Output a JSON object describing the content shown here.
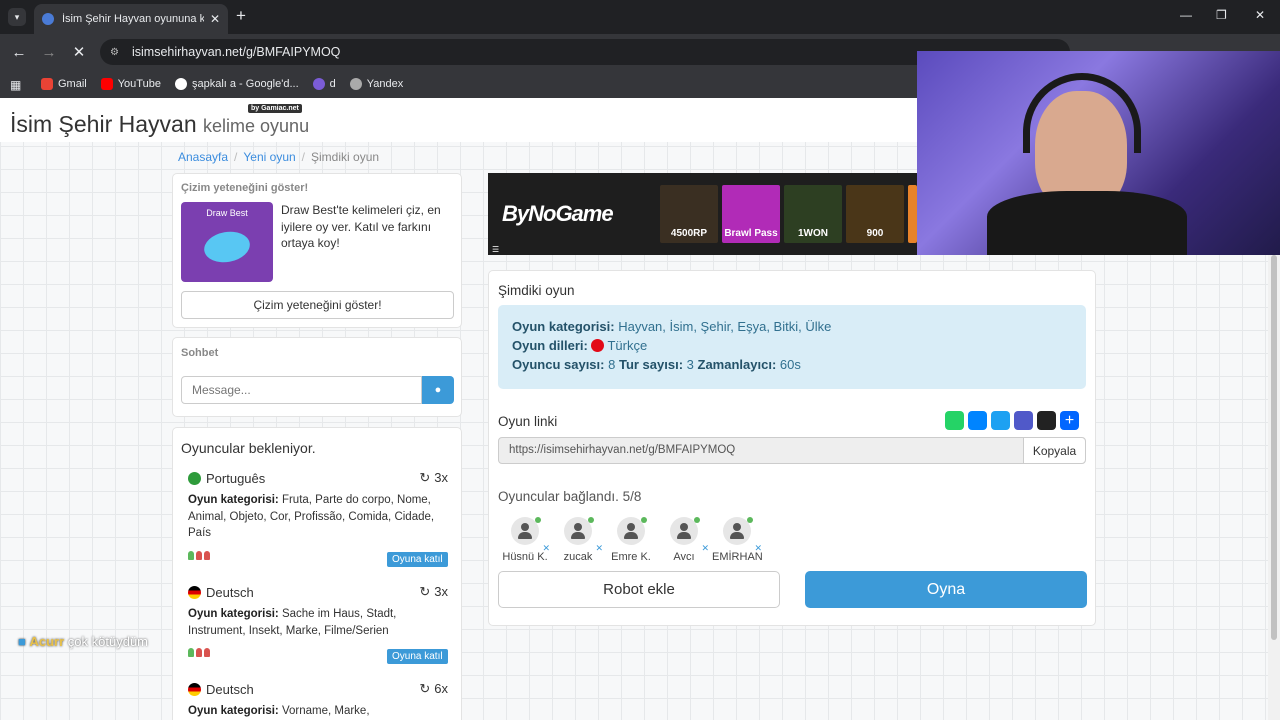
{
  "browser": {
    "tab_title": "İsim Şehir Hayvan oyununa katıl",
    "url": "isimsehirhayvan.net/g/BMFAIPYMOQ",
    "bookmarks": [
      {
        "label": "Gmail"
      },
      {
        "label": "YouTube"
      },
      {
        "label": "şapkalı a - Google'd..."
      },
      {
        "label": "d"
      },
      {
        "label": "Yandex"
      }
    ]
  },
  "site": {
    "title": "İsim Şehir Hayvan",
    "subtitle": "kelime oyunu",
    "badge": "by Gamiac.net"
  },
  "breadcrumb": {
    "home": "Anasayfa",
    "new_game": "Yeni oyun",
    "current": "Şimdiki oyun"
  },
  "draw": {
    "title": "Çizim yeteneğini göster!",
    "img_label": "Draw Best",
    "text": "Draw Best'te kelimeleri çiz, en iyilere oy ver. Katıl ve farkını ortaya koy!",
    "button": "Çizim yeteneğini göster!"
  },
  "chat": {
    "title": "Sohbet",
    "placeholder": "Message..."
  },
  "waiting": {
    "title": "Oyuncular bekleniyor.",
    "join_label": "Oyuna katıl",
    "cat_label": "Oyun kategorisi:",
    "games": [
      {
        "lang": "Português",
        "rounds": "3x",
        "categories": "Fruta, Parte do corpo, Nome, Animal, Objeto, Cor, Profissão, Comida, Cidade, País"
      },
      {
        "lang": "Deutsch",
        "rounds": "3x",
        "categories": "Sache im Haus, Stadt, Instrument, Insekt, Marke, Filme/Serien"
      },
      {
        "lang": "Deutsch",
        "rounds": "6x",
        "categories": "Vorname, Marke,"
      }
    ]
  },
  "ad": {
    "brand": "ByNoGame",
    "tiles": [
      "4500RP",
      "Brawl Pass",
      "1WON",
      "900"
    ]
  },
  "game": {
    "title": "Şimdiki oyun",
    "cat_label": "Oyun kategorisi:",
    "cat_value": "Hayvan, İsim, Şehir, Eşya, Bitki, Ülke",
    "lang_label": "Oyun dilleri:",
    "lang_value": "Türkçe",
    "players_label": "Oyuncu sayısı:",
    "players_value": "8",
    "rounds_label": "Tur sayısı:",
    "rounds_value": "3",
    "timer_label": "Zamanlayıcı:",
    "timer_value": "60s",
    "link_label": "Oyun linki",
    "link_value": "https://isimsehirhayvan.net/g/BMFAIPYMOQ",
    "copy": "Kopyala",
    "connected": "Oyuncular bağlandı. 5/8",
    "players": [
      {
        "name": "Hüsnü K."
      },
      {
        "name": "zucak"
      },
      {
        "name": "Emre K."
      },
      {
        "name": "Avcı"
      },
      {
        "name": "EMİRHAN"
      }
    ],
    "robot_button": "Robot ekle",
    "play_button": "Oyna"
  },
  "overlay": {
    "user": "Acurr",
    "message": "çok kötüydüm"
  },
  "colors": {
    "accent": "#3c9ad8",
    "info_bg": "#d9edf7"
  }
}
